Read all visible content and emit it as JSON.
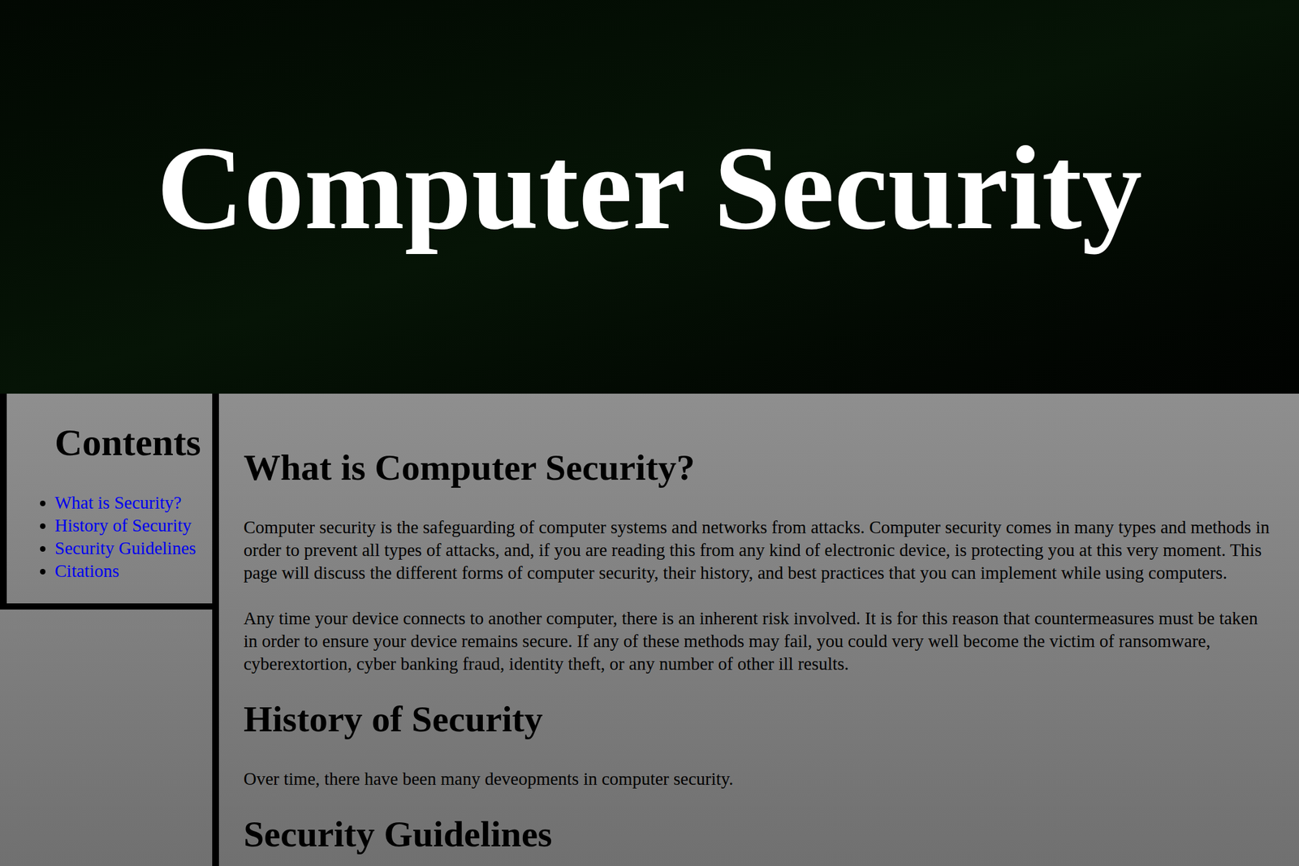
{
  "header": {
    "title": "Computer Security"
  },
  "sidebar": {
    "heading": "Contents",
    "items": [
      {
        "label": "What is Security?"
      },
      {
        "label": "History of Security"
      },
      {
        "label": "Security Guidelines"
      },
      {
        "label": "Citations"
      }
    ]
  },
  "sections": [
    {
      "heading": "What is Computer Security?",
      "paragraphs": [
        "Computer security is the safeguarding of computer systems and networks from attacks. Computer security comes in many types and methods in order to prevent all types of attacks, and, if you are reading this from any kind of electronic device, is protecting you at this very moment. This page will discuss the different forms of computer security, their history, and best practices that you can implement while using computers.",
        "Any time your device connects to another computer, there is an inherent risk involved. It is for this reason that countermeasures must be taken in order to ensure your device remains secure. If any of these methods may fail, you could very well become the victim of ransomware, cyberextortion, cyber banking fraud, identity theft, or any number of other ill results."
      ]
    },
    {
      "heading": "History of Security",
      "paragraphs": [
        "Over time, there have been many deveopments in computer security."
      ]
    },
    {
      "heading": "Security Guidelines",
      "paragraphs": []
    }
  ]
}
